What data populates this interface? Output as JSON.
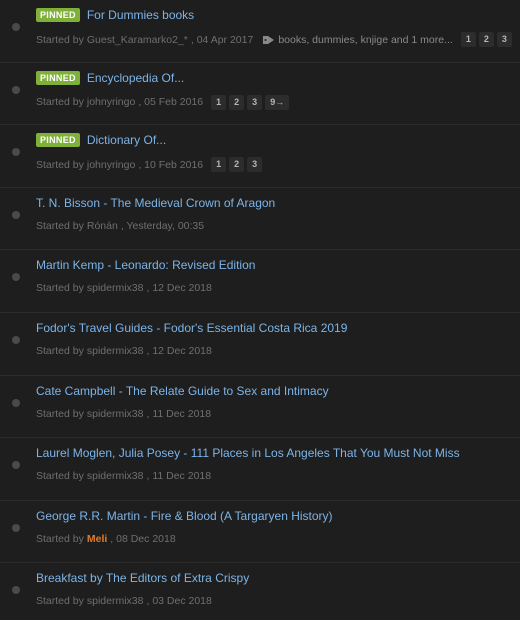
{
  "pinned_label": "PINNED",
  "started_by_prefix": "Started by",
  "topics": [
    {
      "title": "For Dummies books",
      "pinned": true,
      "author": "Guest_Karamarko2_*",
      "date": ", 04 Apr 2017",
      "tags": "books, dummies, knjige and 1 more...",
      "pages": [
        "1",
        "2",
        "3"
      ]
    },
    {
      "title": "Encyclopedia Of...",
      "pinned": true,
      "author": "johnyringo",
      "date": ", 05 Feb 2016",
      "pages": [
        "1",
        "2",
        "3",
        "9→"
      ]
    },
    {
      "title": "Dictionary Of...",
      "pinned": true,
      "author": "johnyringo",
      "date": ", 10 Feb 2016",
      "pages": [
        "1",
        "2",
        "3"
      ]
    },
    {
      "title": "T. N. Bisson - The Medieval Crown of Aragon",
      "pinned": false,
      "author": "Rónán",
      "date": ", Yesterday, 00:35"
    },
    {
      "title": "Martin Kemp - Leonardo: Revised Edition",
      "pinned": false,
      "author": "spidermix38",
      "date": ", 12 Dec 2018"
    },
    {
      "title": "Fodor's Travel Guides - Fodor's Essential Costa Rica 2019",
      "pinned": false,
      "author": "spidermix38",
      "date": ", 12 Dec 2018"
    },
    {
      "title": "Cate Campbell - The Relate Guide to Sex and Intimacy",
      "pinned": false,
      "author": "spidermix38",
      "date": ", 11 Dec 2018"
    },
    {
      "title": "Laurel Moglen, Julia Posey - 111 Places in Los Angeles That You Must Not Miss",
      "pinned": false,
      "author": "spidermix38",
      "date": ", 11 Dec 2018"
    },
    {
      "title": "George R.R. Martin - Fire & Blood (A Targaryen History)",
      "pinned": false,
      "author": "Meli",
      "author_highlight": true,
      "date": ", 08 Dec 2018"
    },
    {
      "title": "Breakfast by The Editors of Extra Crispy",
      "pinned": false,
      "author": "spidermix38",
      "date": ", 03 Dec 2018"
    }
  ],
  "colors": {
    "background": "#1e1e1e",
    "title_link": "#7cb4e8",
    "pinned_badge": "#7fb03a",
    "meta_text": "#6f6f6f",
    "highlight_author": "#e07b2a",
    "divider": "#2b2b2b"
  },
  "icons": {
    "unread": "dot-icon",
    "tags": "tag-icon"
  }
}
